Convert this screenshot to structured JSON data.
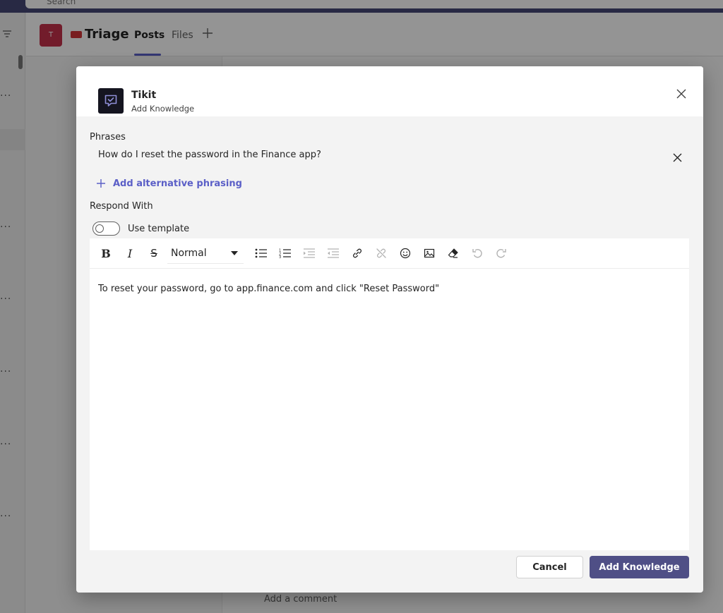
{
  "background": {
    "search_text": "Search",
    "avatar_initial": "T",
    "channel_title": "Triage",
    "tabs": [
      "Posts",
      "Files"
    ],
    "comment_placeholder": "Add a comment"
  },
  "dialog": {
    "app_name": "Tikit",
    "app_subtitle": "Add Knowledge",
    "phrases_label": "Phrases",
    "phrase_text": "How do I reset the password in the Finance app?",
    "add_alt_label": "Add alternative phrasing",
    "respond_label": "Respond With",
    "use_template_label": "Use template",
    "use_template_on": false,
    "format_value": "Normal",
    "body_text": "To reset your password, go to app.finance.com and click \"Reset Password\"",
    "cancel_label": "Cancel",
    "submit_label": "Add Knowledge"
  },
  "colors": {
    "accent": "#5b5fc7",
    "primary_button": "#4f4f86",
    "app_icon_bg": "#151520"
  }
}
